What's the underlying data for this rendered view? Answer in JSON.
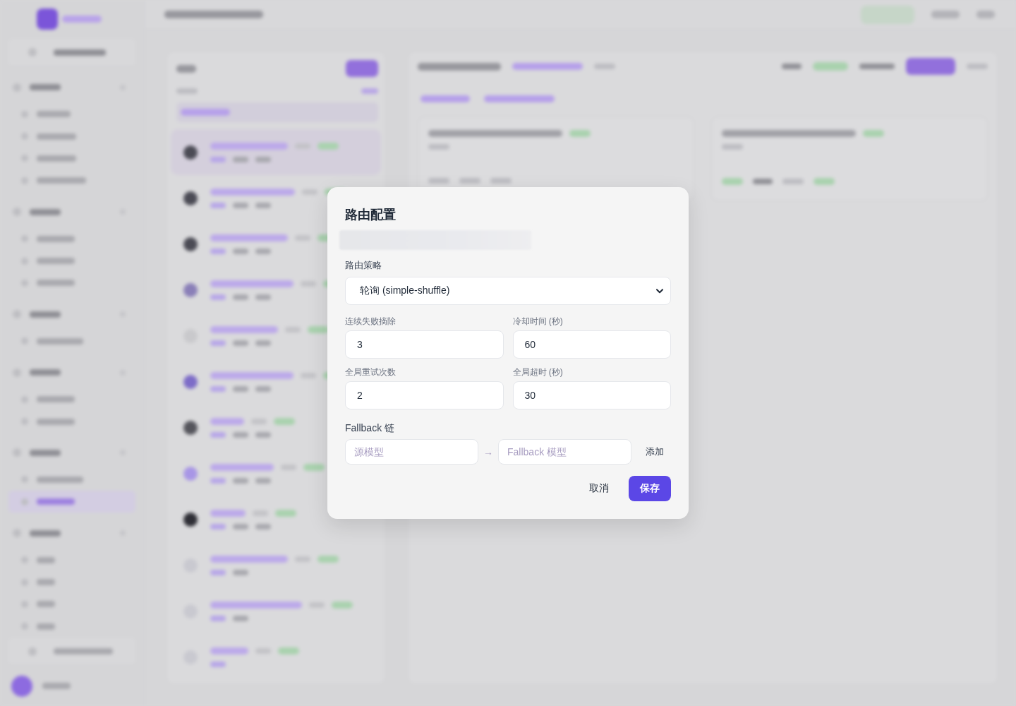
{
  "dialog": {
    "title": "路由配置",
    "strategy": {
      "label": "路由策略",
      "value": "轮询 (simple-shuffle)"
    },
    "fields": [
      {
        "label": "连续失败摘除",
        "value": "3"
      },
      {
        "label": "冷却时间 (秒)",
        "value": "60"
      },
      {
        "label": "全局重试次数",
        "value": "2"
      },
      {
        "label": "全局超时 (秒)",
        "value": "30"
      }
    ],
    "fallback": {
      "label": "Fallback 链",
      "source_placeholder": "源模型",
      "arrow": "→",
      "target_placeholder": "Fallback 模型",
      "add_button": "添加"
    },
    "buttons": [
      {
        "label": "取消",
        "kind": "secondary"
      },
      {
        "label": "保存",
        "kind": "primary"
      }
    ]
  }
}
